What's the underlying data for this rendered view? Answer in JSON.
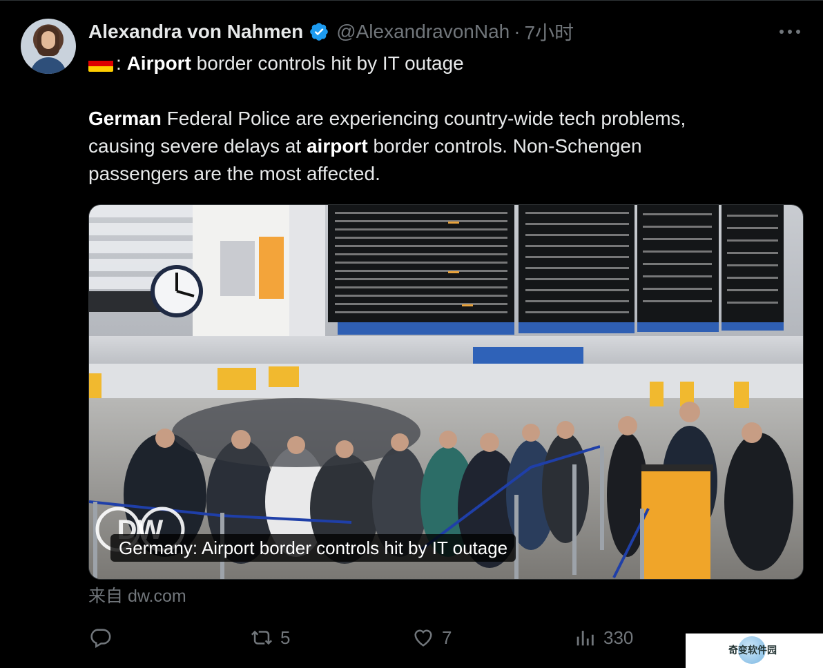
{
  "tweet": {
    "author_name": "Alexandra von Nahmen",
    "author_handle": "@AlexandravonNah",
    "separator": "·",
    "timestamp": "7小时",
    "flag_colors": [
      "#000000",
      "#dd0000",
      "#ffce00"
    ],
    "line1_suffix": ":",
    "line1_bold": "Airport",
    "line1_rest": "border controls hit by IT outage",
    "body": {
      "l1_bold": "German",
      "l1_rest": "Federal Police are experiencing country-wide tech problems,",
      "l2_start": "causing severe delays at",
      "l2_bold": "airport",
      "l2_rest": "border controls. Non-Schengen",
      "l3": "passengers are the most affected."
    }
  },
  "card": {
    "caption": "Germany: Airport border controls hit by IT outage",
    "source": "来自 dw.com",
    "logo_text": "DW"
  },
  "actions": {
    "reply_count": "",
    "retweet_count": "5",
    "like_count": "7",
    "views_count": "330"
  },
  "watermark": {
    "text": "奇变软件园"
  },
  "colors": {
    "verified": "#1d9bf0",
    "muted": "#71767b",
    "text": "#e7e9ea",
    "background": "#000000"
  },
  "icons": [
    "verified-badge-icon",
    "more-options-icon",
    "reply-icon",
    "retweet-icon",
    "like-icon",
    "views-icon"
  ]
}
